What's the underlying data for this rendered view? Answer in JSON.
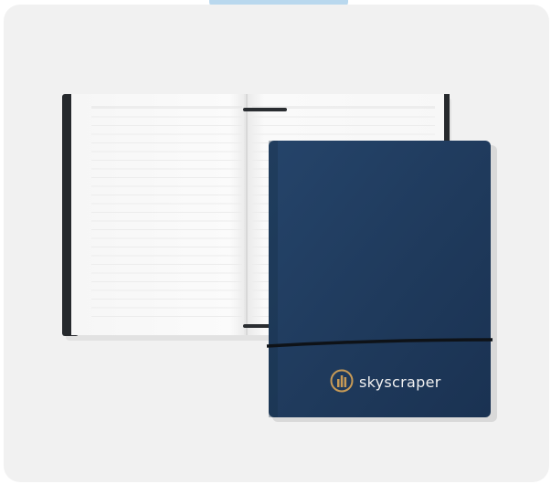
{
  "product": {
    "brand_text": "skyscraper"
  },
  "colors": {
    "card_bg": "#f1f1f1",
    "indicator": "#b9d8ee",
    "cover": "#1f3a5c",
    "logo_gold": "#c79a56",
    "elastic": "#0e1217"
  },
  "icons": {
    "logo": "skyscraper-logo-icon"
  }
}
